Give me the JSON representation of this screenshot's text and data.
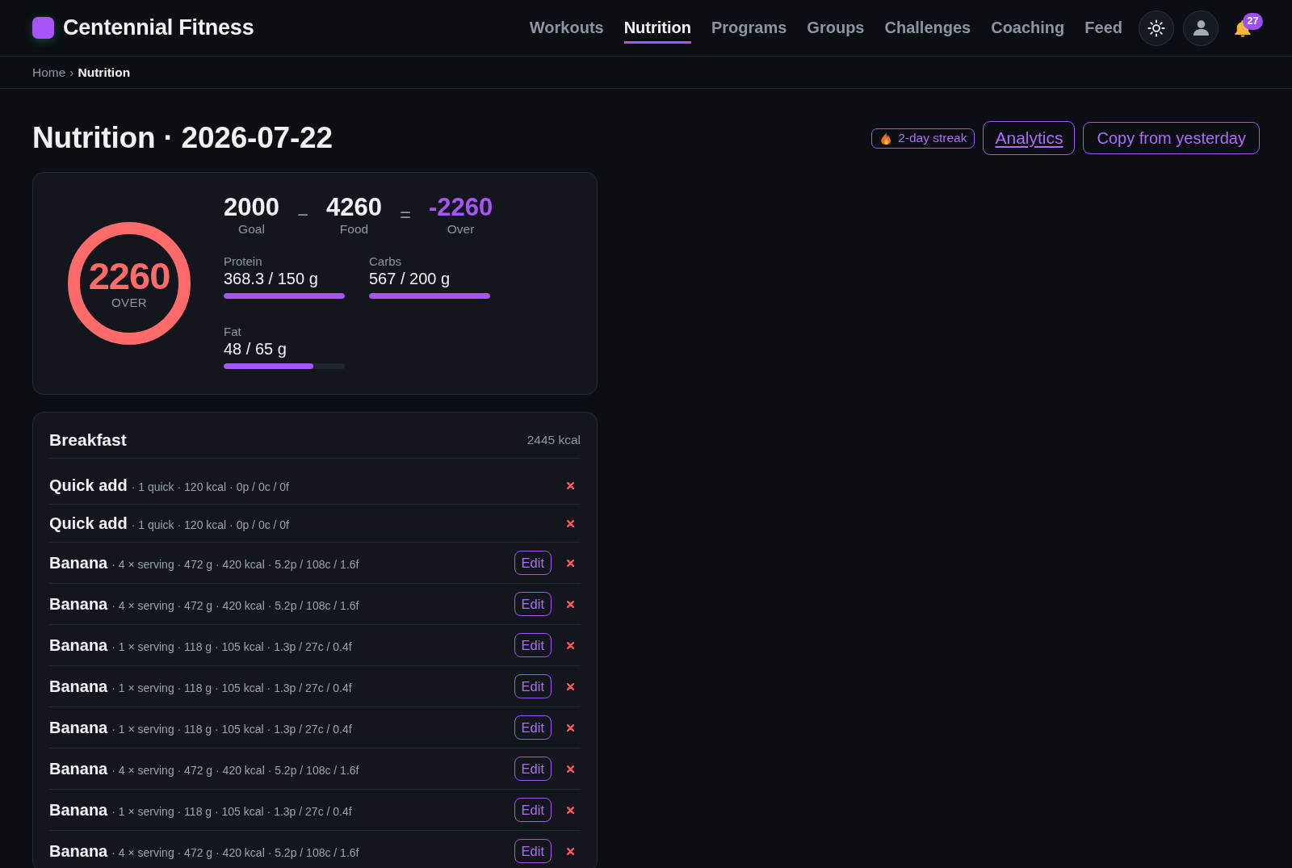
{
  "header": {
    "brand": "Centennial Fitness",
    "nav": [
      {
        "label": "Workouts",
        "selected": false
      },
      {
        "label": "Nutrition",
        "selected": true
      },
      {
        "label": "Programs",
        "selected": false
      },
      {
        "label": "Groups",
        "selected": false
      },
      {
        "label": "Challenges",
        "selected": false
      },
      {
        "label": "Coaching",
        "selected": false
      },
      {
        "label": "Feed",
        "selected": false
      }
    ],
    "notifications": {
      "count": "27"
    }
  },
  "breadcrumb": {
    "separator": "›",
    "items": [
      {
        "label": "Home",
        "current": false
      },
      {
        "label": "Nutrition",
        "current": true
      }
    ]
  },
  "page": {
    "title": "Nutrition · 2026-07-22",
    "streak": {
      "label": "2-day streak"
    },
    "buttons": [
      {
        "label": "Analytics",
        "kind": "link"
      },
      {
        "label": "Copy from yesterday",
        "kind": "outline"
      }
    ]
  },
  "summary": {
    "ring": {
      "value": "2260",
      "label": "OVER"
    },
    "equation": {
      "goal": {
        "value": "2000",
        "label": "Goal"
      },
      "minus": "−",
      "food": {
        "value": "4260",
        "label": "Food"
      },
      "equals": "=",
      "result": {
        "value": "-2260",
        "label": "Over"
      }
    },
    "macros": [
      {
        "name": "Protein",
        "reading": "368.3 / 150 g",
        "level": 1
      },
      {
        "name": "Carbs",
        "reading": "567 / 200 g",
        "level": 1
      },
      {
        "name": "Fat",
        "reading": "48 / 65 g",
        "level": 0.74
      }
    ]
  },
  "meals": [
    {
      "name": "Breakfast",
      "total": "2445 kcal",
      "items": [
        {
          "name": "Quick add",
          "details": "· 1 quick · 120 kcal · 0p / 0c / 0f"
        },
        {
          "name": "Quick add",
          "details": "· 1 quick · 120 kcal · 0p / 0c / 0f"
        },
        {
          "name": "Banana",
          "details": "· 4 × serving · 472 g · 420 kcal · 5.2p / 108c / 1.6f",
          "edit": "Edit"
        },
        {
          "name": "Banana",
          "details": "· 4 × serving · 472 g · 420 kcal · 5.2p / 108c / 1.6f",
          "edit": "Edit"
        },
        {
          "name": "Banana",
          "details": "· 1 × serving · 118 g · 105 kcal · 1.3p / 27c / 0.4f",
          "edit": "Edit"
        },
        {
          "name": "Banana",
          "details": "· 1 × serving · 118 g · 105 kcal · 1.3p / 27c / 0.4f",
          "edit": "Edit"
        },
        {
          "name": "Banana",
          "details": "· 1 × serving · 118 g · 105 kcal · 1.3p / 27c / 0.4f",
          "edit": "Edit"
        },
        {
          "name": "Banana",
          "details": "· 4 × serving · 472 g · 420 kcal · 5.2p / 108c / 1.6f",
          "edit": "Edit"
        },
        {
          "name": "Banana",
          "details": "· 1 × serving · 118 g · 105 kcal · 1.3p / 27c / 0.4f",
          "edit": "Edit"
        },
        {
          "name": "Banana",
          "details": "· 4 × serving · 472 g · 420 kcal · 5.2p / 108c / 1.6f",
          "edit": "Edit"
        }
      ]
    }
  ]
}
